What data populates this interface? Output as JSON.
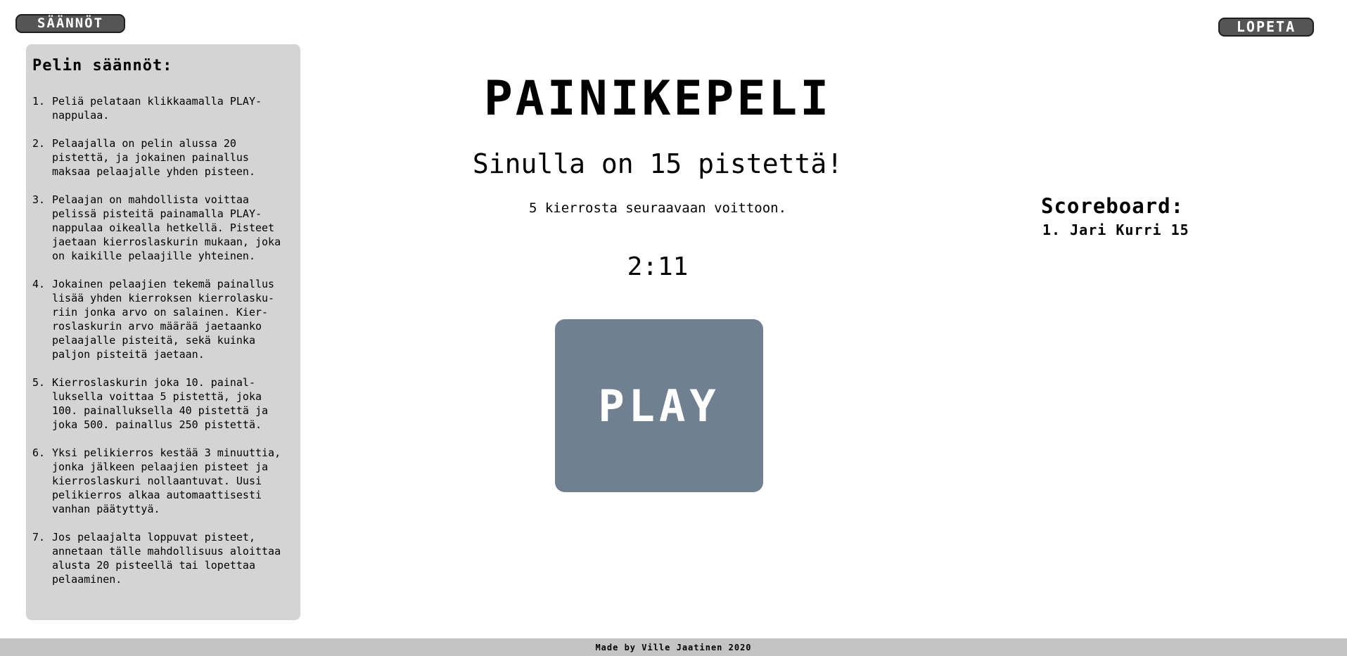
{
  "header": {
    "rules_button_label": "SÄÄNNÖT",
    "quit_button_label": "LOPETA"
  },
  "rules": {
    "title": "Pelin säännöt:",
    "items": [
      {
        "num": "1.",
        "text": "Peliä pelataan klikkaamalla PLAY-\nnappulaa."
      },
      {
        "num": "2.",
        "text": "Pelaajalla on pelin alussa 20\npistettä, ja jokainen painallus\nmaksaa pelaajalle yhden pisteen."
      },
      {
        "num": "3.",
        "text": "Pelaajan on mahdollista voittaa\npelissä pisteitä painamalla PLAY-\nnappulaa oikealla hetkellä. Pisteet\njaetaan kierroslaskurin mukaan, joka\non kaikille pelaajille yhteinen."
      },
      {
        "num": "4.",
        "text": "Jokainen pelaajien tekemä painallus\nlisää yhden kierroksen kierrolasku-\nriin jonka arvo on salainen. Kier-\nroslaskurin arvo määrää jaetaanko\npelaajalle pisteitä, sekä kuinka\npaljon pisteitä jaetaan."
      },
      {
        "num": "5.",
        "text": "Kierroslaskurin joka 10. painal-\nluksella voittaa 5 pistettä, joka\n100. painalluksella 40 pistettä ja\njoka 500. painallus 250 pistettä."
      },
      {
        "num": "6.",
        "text": "Yksi pelikierros kestää 3 minuuttia,\njonka jälkeen pelaajien pisteet ja\nkierroslaskuri nollaantuvat. Uusi\npelikierros alkaa automaattisesti\nvanhan päätyttyä."
      },
      {
        "num": "7.",
        "text": "Jos pelaajalta loppuvat pisteet,\nannetaan tälle mahdollisuus aloittaa\nalusta 20 pisteellä tai lopettaa\npelaaminen."
      }
    ]
  },
  "game": {
    "title": "PAINIKEPELI",
    "points_text": "Sinulla on 15 pistettä!",
    "next_win_text": "5 kierrosta seuraavaan voittoon.",
    "timer": "2:11",
    "play_label": "PLAY",
    "play_button_color": "#708090"
  },
  "scoreboard": {
    "title": "Scoreboard:",
    "entries": [
      {
        "text": "1. Jari Kurri 15"
      }
    ]
  },
  "footer": {
    "text": "Made by Ville Jaatinen 2020"
  }
}
